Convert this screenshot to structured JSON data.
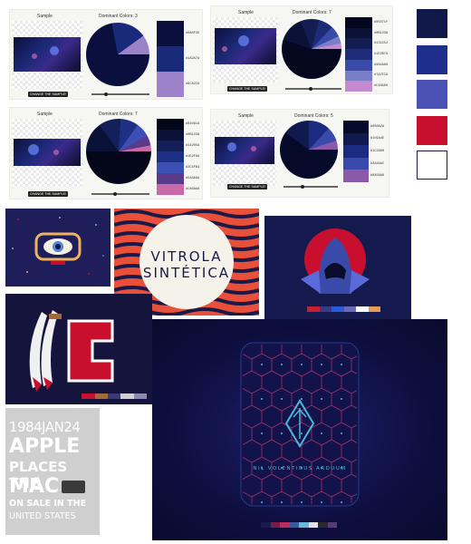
{
  "panels": [
    {
      "sample_label": "Sample",
      "dominant_label": "Dominant Colors: 3",
      "button_label": "CHANGE THE SAMPLE!",
      "colors": [
        "#0a0f3d",
        "#1a2a7a",
        "#9c82c8"
      ],
      "hex": [
        "#0A0F3D",
        "#1A2A7A",
        "#9C82C8"
      ],
      "fractions": [
        0.72,
        0.18,
        0.1
      ],
      "slider": 0.25
    },
    {
      "sample_label": "Sample",
      "dominant_label": "Dominant Colors: 7",
      "button_label": "CHANGE THE SAMPLE!",
      "colors": [
        "#05071f",
        "#0b1238",
        "#131d52",
        "#1e2b78",
        "#3a4aa8",
        "#7a7ec8",
        "#c48ad0"
      ],
      "hex": [
        "#05071F",
        "#0B1238",
        "#131D52",
        "#1E2B78",
        "#3A4AA8",
        "#7A7EC8",
        "#C48AD0"
      ],
      "fractions": [
        0.55,
        0.14,
        0.1,
        0.08,
        0.06,
        0.04,
        0.03
      ],
      "slider": 0.45
    },
    {
      "sample_label": "Sample",
      "dominant_label": "Dominant Colors: 7",
      "button_label": "CHANGE THE SAMPLE!",
      "colors": [
        "#04061a",
        "#0b1238",
        "#14205a",
        "#1e2f86",
        "#3c4fb4",
        "#5a3a8a",
        "#c86aa8"
      ],
      "hex": [
        "#04061A",
        "#0B1238",
        "#14205A",
        "#1E2F86",
        "#3C4FB4",
        "#5A3A8A",
        "#C86AA8"
      ],
      "fractions": [
        0.5,
        0.15,
        0.11,
        0.09,
        0.07,
        0.05,
        0.03
      ],
      "slider": 0.4
    },
    {
      "sample_label": "Sample",
      "dominant_label": "Dominant Colors: 5",
      "button_label": "CHANGE THE SAMPLE!",
      "colors": [
        "#060a2a",
        "#101a4e",
        "#1c2a80",
        "#3a4aac",
        "#8a5aa8"
      ],
      "hex": [
        "#060A2A",
        "#101A4E",
        "#1C2A80",
        "#3A4AAC",
        "#8A5AA8"
      ],
      "fractions": [
        0.6,
        0.15,
        0.12,
        0.08,
        0.05
      ],
      "slider": 0.35
    }
  ],
  "palette": [
    {
      "name": "navy",
      "hex": "#101849"
    },
    {
      "name": "royal-blue",
      "hex": "#1d2f8a"
    },
    {
      "name": "indigo",
      "hex": "#4a52b6"
    },
    {
      "name": "crimson",
      "hex": "#c8102e"
    },
    {
      "name": "white",
      "hex": "#ffffff"
    }
  ],
  "vitrola": {
    "line1": "VITROLA",
    "line2": "SINTÉTICA"
  },
  "geo": {
    "caption": "NIL VOLENTIBUS ARDUUM",
    "palette": [
      "#1a1a4a",
      "#7a1a4a",
      "#c02a5a",
      "#3a5aa0",
      "#6ab8d8",
      "#e0e0e0",
      "#2a2a2a",
      "#5a3a7a"
    ]
  },
  "hood": {
    "palette": [
      "#1a1a4a",
      "#c82030",
      "#3a3a8a",
      "#2a5ad8",
      "#6a6ab8",
      "#ffffff",
      "#e89a5a"
    ]
  },
  "cleveland": {
    "palette": [
      "#14143c",
      "#c8102e",
      "#a06a3a",
      "#3a3a7a",
      "#d0d0d0",
      "#8a8ab0"
    ]
  },
  "apple": {
    "lines": [
      "1984JAN24",
      "APPLE",
      "PLACES THE",
      "MAC",
      "ON SALE IN THE",
      "UNITED STATES"
    ]
  }
}
